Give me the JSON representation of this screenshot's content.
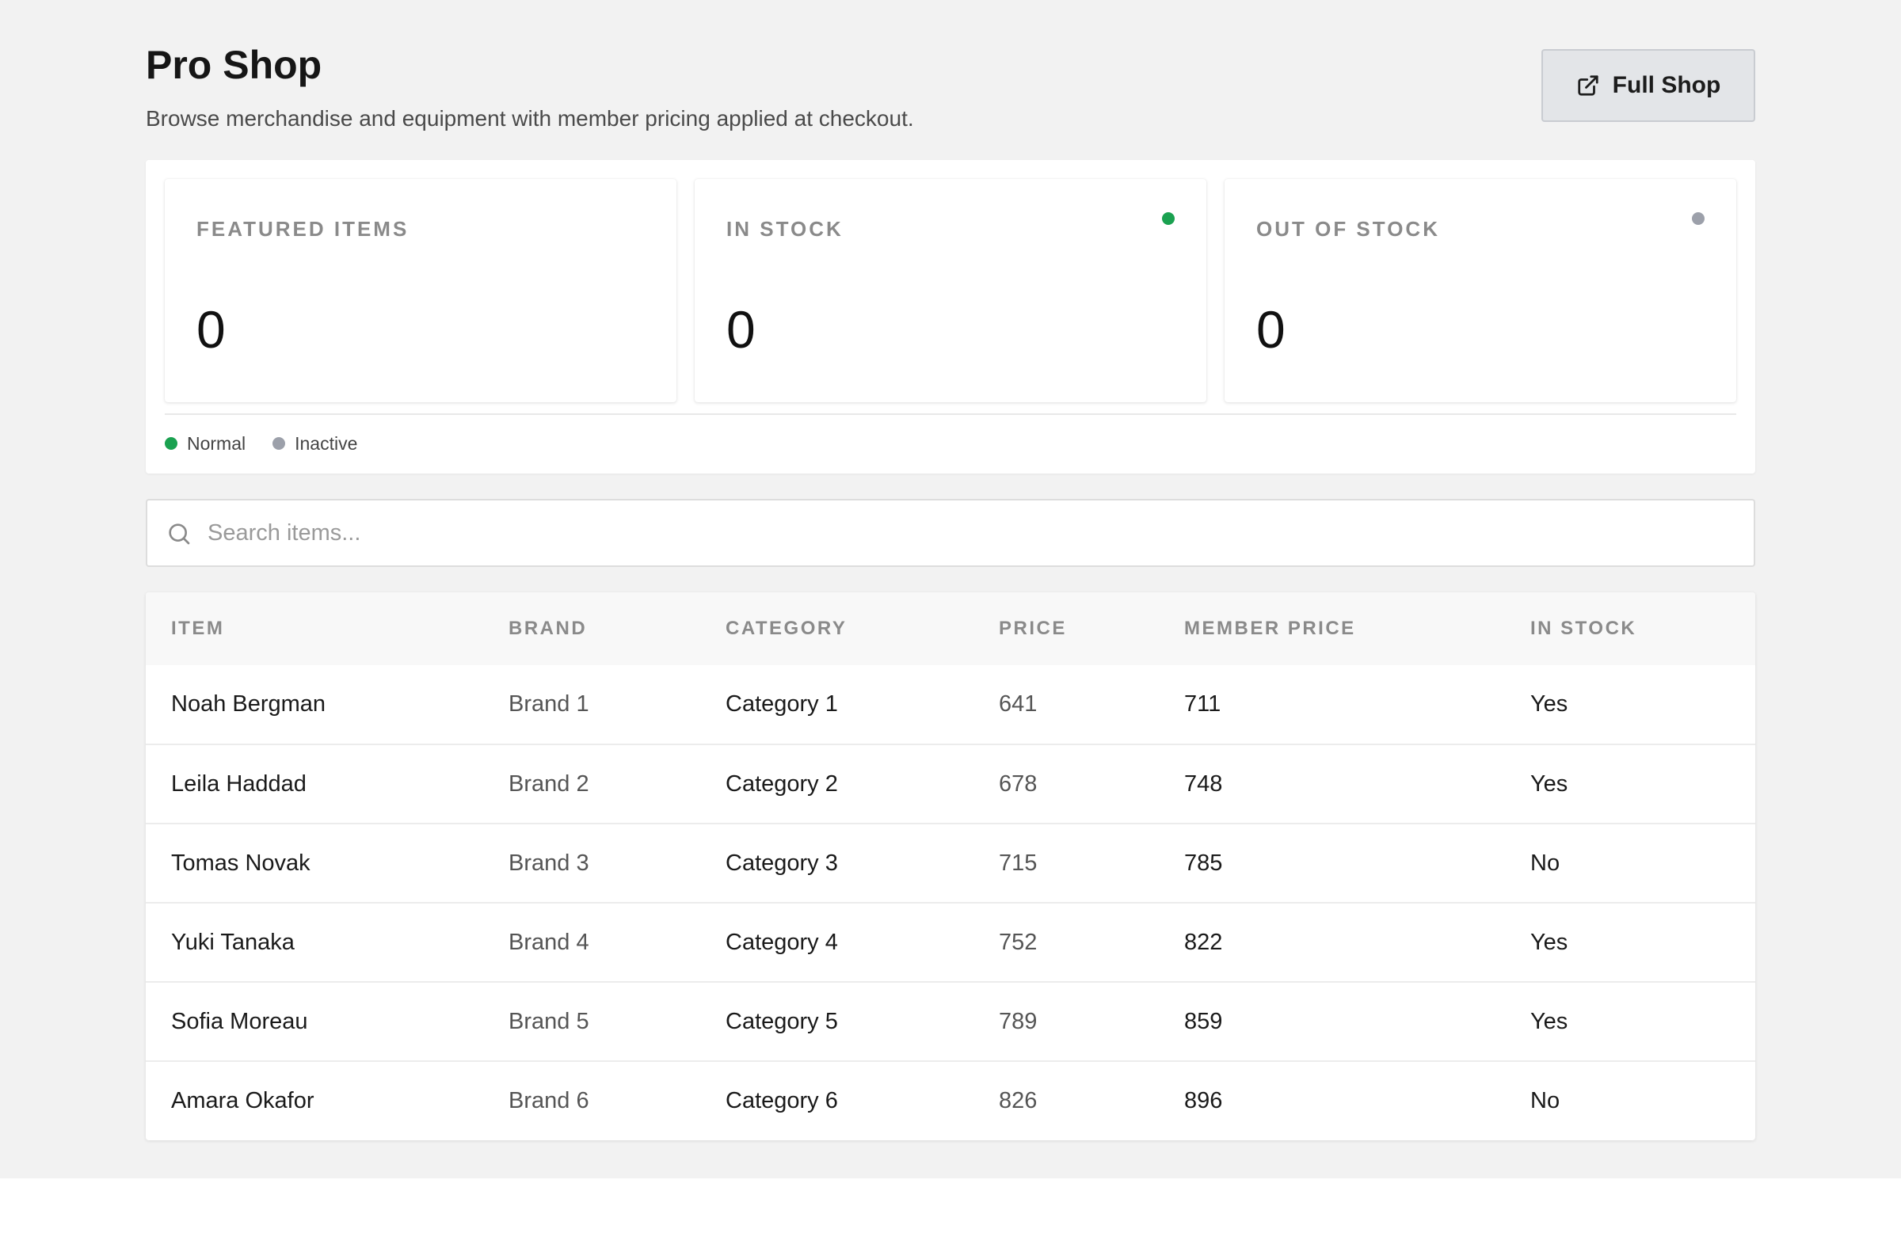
{
  "header": {
    "title": "Pro Shop",
    "subtitle": "Browse merchandise and equipment with member pricing applied at checkout.",
    "full_shop_label": "Full Shop",
    "full_shop_icon": "external-link-icon"
  },
  "stats": [
    {
      "label": "FEATURED ITEMS",
      "value": "0"
    },
    {
      "label": "IN STOCK",
      "value": "0",
      "status": "Normal"
    },
    {
      "label": "OUT OF STOCK",
      "value": "0",
      "status": "Inactive"
    }
  ],
  "legend": [
    {
      "label": "Normal",
      "color": "#1aa150"
    },
    {
      "label": "Inactive",
      "color": "#9ca0aa"
    }
  ],
  "search": {
    "placeholder": "Search items...",
    "icon": "search-icon"
  },
  "table": {
    "columns": [
      "ITEM",
      "BRAND",
      "CATEGORY",
      "PRICE",
      "MEMBER PRICE",
      "IN STOCK"
    ],
    "rows": [
      {
        "item": "Noah Bergman",
        "brand": "Brand 1",
        "category": "Category 1",
        "price": "641",
        "member_price": "711",
        "in_stock": "Yes"
      },
      {
        "item": "Leila Haddad",
        "brand": "Brand 2",
        "category": "Category 2",
        "price": "678",
        "member_price": "748",
        "in_stock": "Yes"
      },
      {
        "item": "Tomas Novak",
        "brand": "Brand 3",
        "category": "Category 3",
        "price": "715",
        "member_price": "785",
        "in_stock": "No"
      },
      {
        "item": "Yuki Tanaka",
        "brand": "Brand 4",
        "category": "Category 4",
        "price": "752",
        "member_price": "822",
        "in_stock": "Yes"
      },
      {
        "item": "Sofia Moreau",
        "brand": "Brand 5",
        "category": "Category 5",
        "price": "789",
        "member_price": "859",
        "in_stock": "Yes"
      },
      {
        "item": "Amara Okafor",
        "brand": "Brand 6",
        "category": "Category 6",
        "price": "826",
        "member_price": "896",
        "in_stock": "No"
      }
    ]
  },
  "colors": {
    "normal": "#1aa150",
    "inactive": "#9ca0aa"
  }
}
